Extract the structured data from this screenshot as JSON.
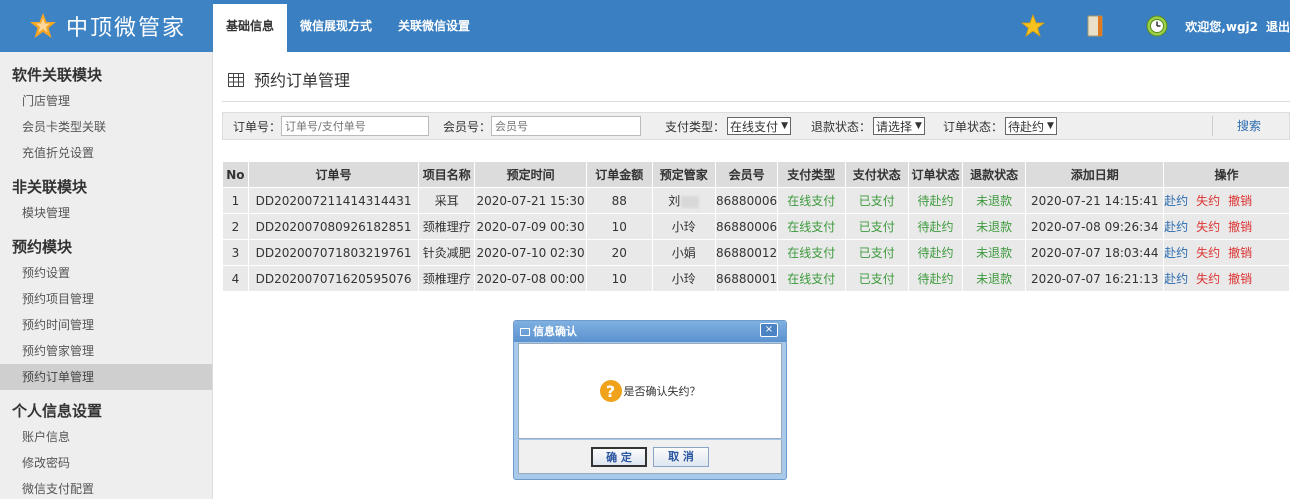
{
  "brand": {
    "name": "中顶微管家"
  },
  "nav": {
    "tabs": [
      {
        "label": "基础信息",
        "active": true
      },
      {
        "label": "微信展现方式",
        "active": false
      },
      {
        "label": "关联微信设置",
        "active": false
      }
    ]
  },
  "topright": {
    "icons": [
      "star-icon",
      "notebook-icon",
      "clock-icon"
    ],
    "welcome": "欢迎您,wgj2",
    "logout": "退出"
  },
  "sidebar": {
    "sections": [
      {
        "title": "软件关联模块",
        "items": [
          "门店管理",
          "会员卡类型关联",
          "充值折兑设置"
        ]
      },
      {
        "title": "非关联模块",
        "items": [
          "模块管理"
        ]
      },
      {
        "title": "预约模块",
        "items": [
          "预约设置",
          "预约项目管理",
          "预约时间管理",
          "预约管家管理",
          "预约订单管理"
        ]
      },
      {
        "title": "个人信息设置",
        "items": [
          "账户信息",
          "修改密码",
          "微信支付配置"
        ]
      }
    ],
    "active_item": "预约订单管理"
  },
  "page": {
    "title": "预约订单管理"
  },
  "search": {
    "order_label": "订单号：",
    "order_placeholder": "订单号/支付单号",
    "member_label": "会员号：",
    "member_placeholder": "会员号",
    "pay_type_label": "支付类型：",
    "pay_type_value": "在线支付",
    "refund_label": "退款状态：",
    "refund_value": "请选择",
    "order_status_label": "订单状态：",
    "order_status_value": "待赴约",
    "search_button": "搜索"
  },
  "table": {
    "headers": [
      "No",
      "订单号",
      "项目名称",
      "预定时间",
      "订单金额",
      "预定管家",
      "会员号",
      "支付类型",
      "支付状态",
      "订单状态",
      "退款状态",
      "添加日期",
      "操作"
    ],
    "rows": [
      {
        "no": "1",
        "order": "DD202007211414314431",
        "project": "采耳",
        "time": "2020-07-21 15:30",
        "amount": "88",
        "keeper": "刘",
        "member": "86880006",
        "pay_type": "在线支付",
        "pay_status": "已支付",
        "order_status": "待赴约",
        "refund": "未退款",
        "added": "2020-07-21 14:15:41"
      },
      {
        "no": "2",
        "order": "DD202007080926182851",
        "project": "颈椎理疗",
        "time": "2020-07-09 00:30",
        "amount": "10",
        "keeper": "小玲",
        "member": "86880006",
        "pay_type": "在线支付",
        "pay_status": "已支付",
        "order_status": "待赴约",
        "refund": "未退款",
        "added": "2020-07-08 09:26:34"
      },
      {
        "no": "3",
        "order": "DD202007071803219761",
        "project": "针灸减肥",
        "time": "2020-07-10 02:30",
        "amount": "20",
        "keeper": "小娟",
        "member": "86880012",
        "pay_type": "在线支付",
        "pay_status": "已支付",
        "order_status": "待赴约",
        "refund": "未退款",
        "added": "2020-07-07 18:03:44"
      },
      {
        "no": "4",
        "order": "DD202007071620595076",
        "project": "颈椎理疗",
        "time": "2020-07-08 00:00",
        "amount": "10",
        "keeper": "小玲",
        "member": "86880001",
        "pay_type": "在线支付",
        "pay_status": "已支付",
        "order_status": "待赴约",
        "refund": "未退款",
        "added": "2020-07-07 16:21:13"
      }
    ],
    "actions": {
      "go": "赴约",
      "miss": "失约",
      "cancel": "撤销"
    }
  },
  "dialog": {
    "title": "信息确认",
    "close": "×",
    "message": "是否确认失约？",
    "ok": "确 定",
    "cancel": "取 消"
  },
  "colors": {
    "topbar": "#3a7fc1",
    "green": "#3d9a3d",
    "red": "#dd3333",
    "link": "#2a6bb0",
    "question": "#f0a21a"
  }
}
